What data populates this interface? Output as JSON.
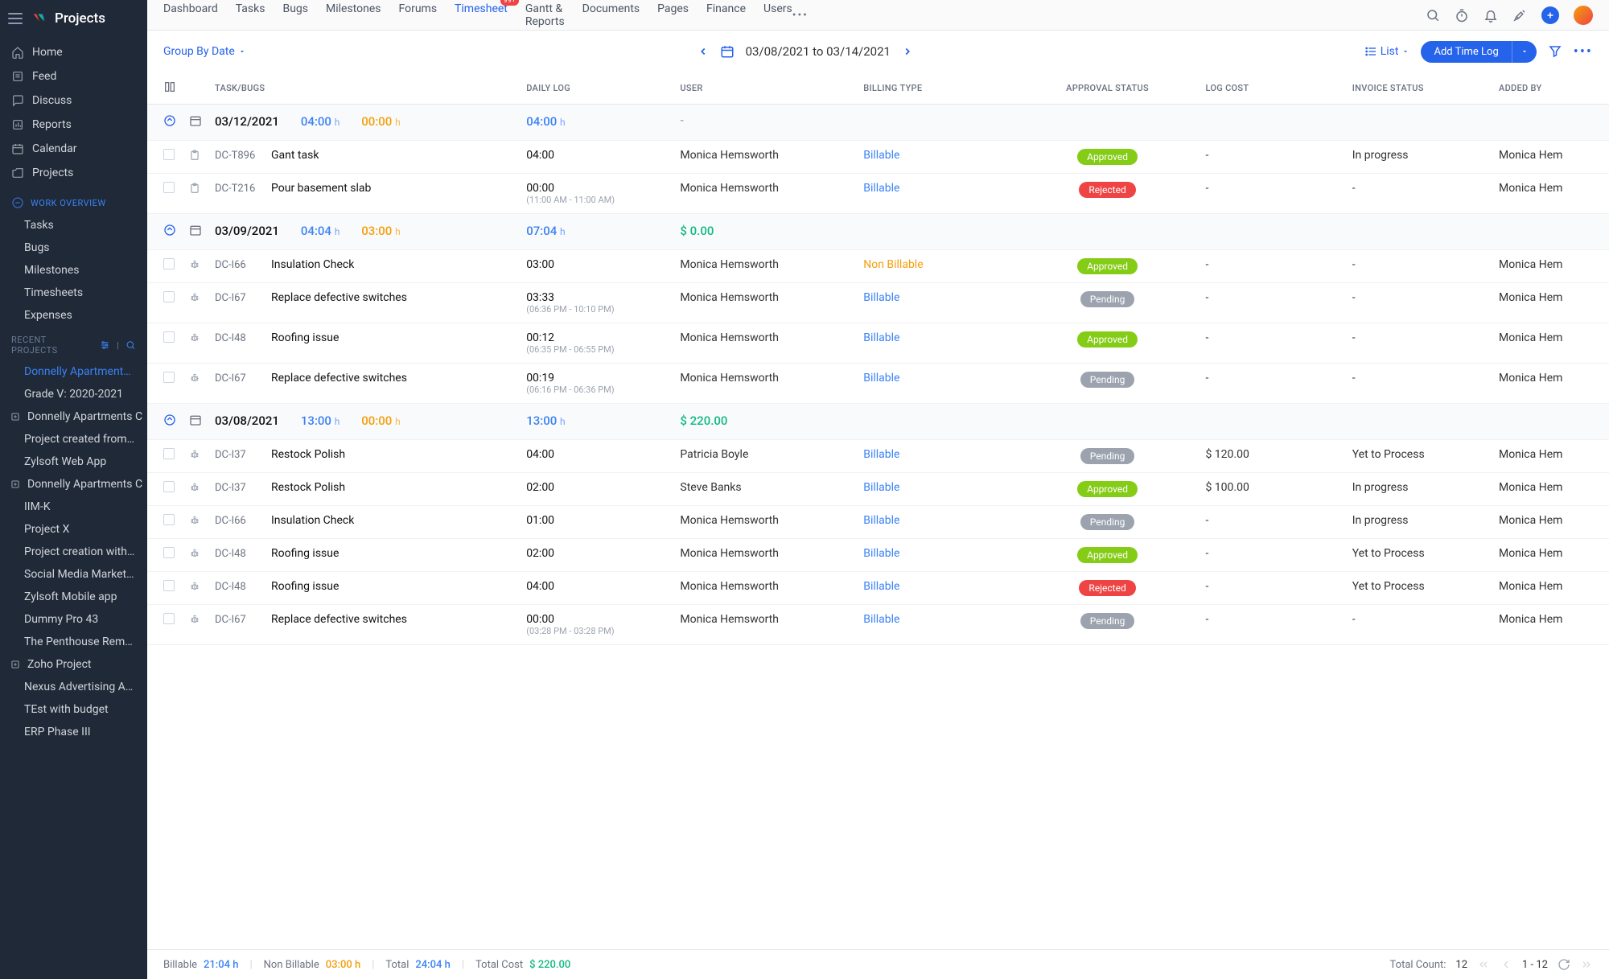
{
  "app": {
    "name": "Projects"
  },
  "sidebar": {
    "primary": [
      {
        "label": "Home",
        "icon": "home"
      },
      {
        "label": "Feed",
        "icon": "feed"
      },
      {
        "label": "Discuss",
        "icon": "discuss"
      },
      {
        "label": "Reports",
        "icon": "reports"
      },
      {
        "label": "Calendar",
        "icon": "calendar"
      },
      {
        "label": "Projects",
        "icon": "projects"
      }
    ],
    "work_overview_label": "WORK OVERVIEW",
    "work_overview": [
      {
        "label": "Tasks"
      },
      {
        "label": "Bugs"
      },
      {
        "label": "Milestones"
      },
      {
        "label": "Timesheets"
      },
      {
        "label": "Expenses"
      }
    ],
    "recent_label": "RECENT PROJECTS",
    "recent": [
      {
        "label": "Donnelly Apartments C",
        "active": true
      },
      {
        "label": "Grade V: 2020-2021"
      },
      {
        "label": "Donnelly Apartments C",
        "tree": true
      },
      {
        "label": "Project created from CF"
      },
      {
        "label": "Zylsoft Web App"
      },
      {
        "label": "Donnelly Apartments C",
        "tree": true
      },
      {
        "label": "IIM-K"
      },
      {
        "label": "Project X"
      },
      {
        "label": "Project creation with la"
      },
      {
        "label": "Social Media Marketing"
      },
      {
        "label": "Zylsoft Mobile app"
      },
      {
        "label": "Dummy Pro 43"
      },
      {
        "label": "The Penthouse Remode"
      },
      {
        "label": "Zoho Project",
        "tree": true
      },
      {
        "label": "Nexus Advertising Agen"
      },
      {
        "label": "TEst with budget"
      },
      {
        "label": "ERP Phase III"
      }
    ]
  },
  "topnav": {
    "tabs": [
      "Dashboard",
      "Tasks",
      "Bugs",
      "Milestones",
      "Forums",
      "Timesheet",
      "Gantt & Reports",
      "Documents",
      "Pages",
      "Finance",
      "Users"
    ],
    "active": "Timesheet",
    "badge": "99+"
  },
  "toolbar": {
    "group_by": "Group By Date",
    "date_range": "03/08/2021 to 03/14/2021",
    "view_label": "List",
    "add_log": "Add Time Log"
  },
  "columns": [
    "",
    "",
    "TASK/BUGS",
    "DAILY LOG",
    "USER",
    "BILLING TYPE",
    "APPROVAL STATUS",
    "LOG COST",
    "INVOICE STATUS",
    "ADDED BY"
  ],
  "groups": [
    {
      "date": "03/12/2021",
      "h1": "04:00",
      "h2": "00:00",
      "h3": "04:00",
      "cost": "-",
      "rows": [
        {
          "icon": "task",
          "id": "DC-T896",
          "name": "Gant task",
          "log": "04:00",
          "sub": "",
          "user": "Monica Hemsworth",
          "billing": "Billable",
          "status": "Approved",
          "cost": "-",
          "invoice": "In progress",
          "added": "Monica Hem"
        },
        {
          "icon": "task",
          "id": "DC-T216",
          "name": "Pour basement slab",
          "log": "00:00",
          "sub": "(11:00 AM - 11:00 AM)",
          "user": "Monica Hemsworth",
          "billing": "Billable",
          "status": "Rejected",
          "cost": "-",
          "invoice": "-",
          "added": "Monica Hem"
        }
      ]
    },
    {
      "date": "03/09/2021",
      "h1": "04:04",
      "h2": "03:00",
      "h3": "07:04",
      "cost": "$ 0.00",
      "rows": [
        {
          "icon": "bug",
          "id": "DC-I66",
          "name": "Insulation Check",
          "log": "03:00",
          "sub": "",
          "user": "Monica Hemsworth",
          "billing": "Non Billable",
          "status": "Approved",
          "cost": "-",
          "invoice": "-",
          "added": "Monica Hem"
        },
        {
          "icon": "bug",
          "id": "DC-I67",
          "name": "Replace defective switches",
          "log": "03:33",
          "sub": "(06:36 PM - 10:10 PM)",
          "user": "Monica Hemsworth",
          "billing": "Billable",
          "status": "Pending",
          "cost": "-",
          "invoice": "-",
          "added": "Monica Hem"
        },
        {
          "icon": "bug",
          "id": "DC-I48",
          "name": "Roofing issue",
          "log": "00:12",
          "sub": "(06:35 PM - 06:55 PM)",
          "user": "Monica Hemsworth",
          "billing": "Billable",
          "status": "Approved",
          "cost": "-",
          "invoice": "-",
          "added": "Monica Hem"
        },
        {
          "icon": "bug",
          "id": "DC-I67",
          "name": "Replace defective switches",
          "log": "00:19",
          "sub": "(06:16 PM - 06:36 PM)",
          "user": "Monica Hemsworth",
          "billing": "Billable",
          "status": "Pending",
          "cost": "-",
          "invoice": "-",
          "added": "Monica Hem"
        }
      ]
    },
    {
      "date": "03/08/2021",
      "h1": "13:00",
      "h2": "00:00",
      "h3": "13:00",
      "cost": "$ 220.00",
      "rows": [
        {
          "icon": "bug",
          "id": "DC-I37",
          "name": "Restock Polish",
          "log": "04:00",
          "sub": "",
          "user": "Patricia Boyle",
          "billing": "Billable",
          "status": "Pending",
          "cost": "$ 120.00",
          "invoice": "Yet to Process",
          "added": "Monica Hem"
        },
        {
          "icon": "bug",
          "id": "DC-I37",
          "name": "Restock Polish",
          "log": "02:00",
          "sub": "",
          "user": "Steve Banks",
          "billing": "Billable",
          "status": "Approved",
          "cost": "$ 100.00",
          "invoice": "In progress",
          "added": "Monica Hem"
        },
        {
          "icon": "bug",
          "id": "DC-I66",
          "name": "Insulation Check",
          "log": "01:00",
          "sub": "",
          "user": "Monica Hemsworth",
          "billing": "Billable",
          "status": "Pending",
          "cost": "-",
          "invoice": "In progress",
          "added": "Monica Hem"
        },
        {
          "icon": "bug",
          "id": "DC-I48",
          "name": "Roofing issue",
          "log": "02:00",
          "sub": "",
          "user": "Monica Hemsworth",
          "billing": "Billable",
          "status": "Approved",
          "cost": "-",
          "invoice": "Yet to Process",
          "added": "Monica Hem"
        },
        {
          "icon": "bug",
          "id": "DC-I48",
          "name": "Roofing issue",
          "log": "04:00",
          "sub": "",
          "user": "Monica Hemsworth",
          "billing": "Billable",
          "status": "Rejected",
          "cost": "-",
          "invoice": "Yet to Process",
          "added": "Monica Hem"
        },
        {
          "icon": "bug",
          "id": "DC-I67",
          "name": "Replace defective switches",
          "log": "00:00",
          "sub": "(03:28 PM - 03:28 PM)",
          "user": "Monica Hemsworth",
          "billing": "Billable",
          "status": "Pending",
          "cost": "-",
          "invoice": "-",
          "added": "Monica Hem"
        }
      ]
    }
  ],
  "footer": {
    "billable_label": "Billable",
    "billable_val": "21:04 h",
    "nonbillable_label": "Non Billable",
    "nonbillable_val": "03:00 h",
    "total_label": "Total",
    "total_val": "24:04 h",
    "totalcost_label": "Total Cost",
    "totalcost_val": "$ 220.00",
    "count_label": "Total Count:",
    "count_val": "12",
    "range": "1 - 12"
  }
}
